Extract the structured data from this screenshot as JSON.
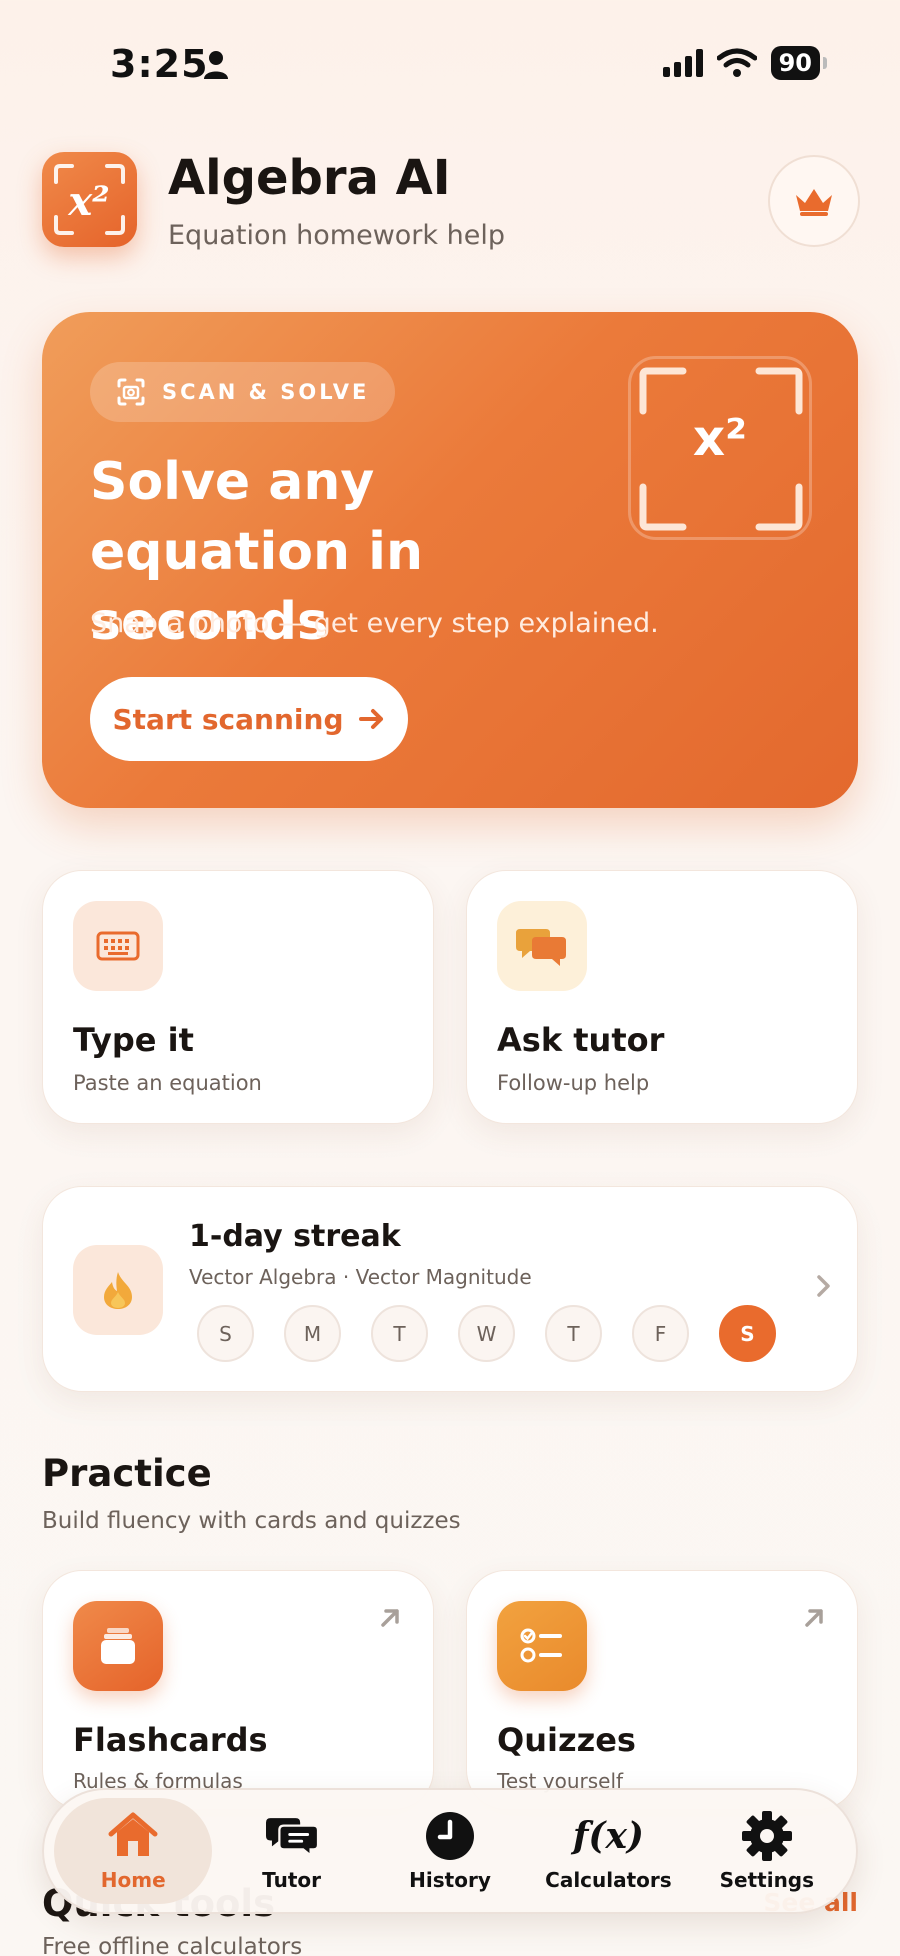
{
  "status_bar": {
    "time": "3:25",
    "battery": "90"
  },
  "header": {
    "title": "Algebra AI",
    "subtitle": "Equation homework help",
    "logo_glyph": "x²"
  },
  "hero": {
    "badge": "SCAN & SOLVE",
    "title": "Solve any equation in seconds",
    "subtitle": "Snap a photo — get every step explained.",
    "button": "Start scanning",
    "frame_glyph": "x²"
  },
  "actions": [
    {
      "title": "Type it",
      "subtitle": "Paste an equation",
      "icon": "keyboard-icon"
    },
    {
      "title": "Ask tutor",
      "subtitle": "Follow-up help",
      "icon": "chat-icon"
    }
  ],
  "streak": {
    "title": "1-day streak",
    "subtitle": "Vector Algebra · Vector Magnitude",
    "days": [
      "S",
      "M",
      "T",
      "W",
      "T",
      "F",
      "S"
    ],
    "active_day_index": 6
  },
  "practice": {
    "title": "Practice",
    "subtitle": "Build fluency with cards and quizzes",
    "cards": [
      {
        "title": "Flashcards",
        "subtitle": "Rules & formulas",
        "icon": "cards-icon"
      },
      {
        "title": "Quizzes",
        "subtitle": "Test yourself",
        "icon": "checklist-icon"
      }
    ]
  },
  "quick_tools": {
    "title": "Quick tools",
    "subtitle": "Free offline calculators",
    "link": "See all"
  },
  "nav": [
    {
      "label": "Home",
      "icon": "home-icon",
      "active": true
    },
    {
      "label": "Tutor",
      "icon": "chat-icon"
    },
    {
      "label": "History",
      "icon": "clock-icon"
    },
    {
      "label": "Calculators",
      "icon": "function-icon",
      "glyph": "f(x)"
    },
    {
      "label": "Settings",
      "icon": "gear-icon"
    }
  ],
  "colors": {
    "accent": "#e96b2d",
    "accent_light": "#fbe7da",
    "background": "#fcf6f2"
  }
}
